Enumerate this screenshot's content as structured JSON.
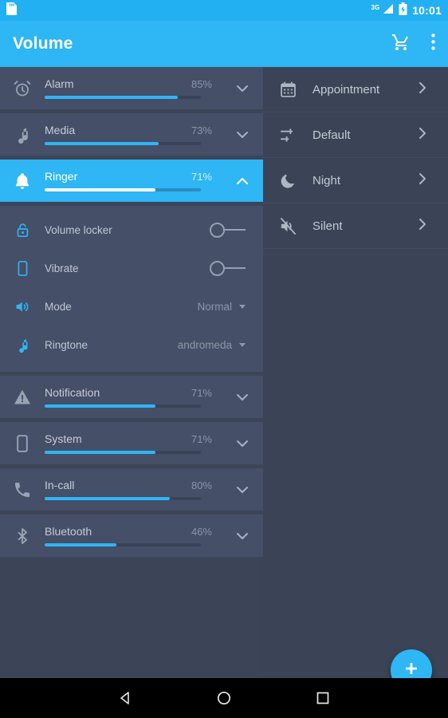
{
  "statusbar": {
    "sd_icon": "sd-card-icon",
    "network": "3G",
    "battery_icon": "battery-charging-icon",
    "time": "10:01"
  },
  "appbar": {
    "title": "Volume",
    "cart_icon": "shopping-cart-icon",
    "overflow_icon": "more-vertical-icon"
  },
  "volumes": [
    {
      "label": "Alarm",
      "percent": "85%",
      "value": 85,
      "icon": "alarm-clock-icon",
      "expanded": false,
      "selected": false,
      "chevron": "chevron-down-icon"
    },
    {
      "label": "Media",
      "percent": "73%",
      "value": 73,
      "icon": "music-note-icon",
      "expanded": false,
      "selected": false,
      "chevron": "chevron-down-icon"
    },
    {
      "label": "Ringer",
      "percent": "71%",
      "value": 71,
      "icon": "bell-icon",
      "expanded": true,
      "selected": true,
      "chevron": "chevron-up-icon"
    },
    {
      "label": "Notification",
      "percent": "71%",
      "value": 71,
      "icon": "warning-icon",
      "expanded": false,
      "selected": false,
      "chevron": "chevron-down-icon"
    },
    {
      "label": "System",
      "percent": "71%",
      "value": 71,
      "icon": "phone-body-icon",
      "expanded": false,
      "selected": false,
      "chevron": "chevron-down-icon"
    },
    {
      "label": "In-call",
      "percent": "80%",
      "value": 80,
      "icon": "phone-call-icon",
      "expanded": false,
      "selected": false,
      "chevron": "chevron-down-icon"
    },
    {
      "label": "Bluetooth",
      "percent": "46%",
      "value": 46,
      "icon": "bluetooth-icon",
      "expanded": false,
      "selected": false,
      "chevron": "chevron-down-icon"
    }
  ],
  "ringer_options": {
    "volume_locker": {
      "label": "Volume locker",
      "icon": "unlock-icon",
      "type": "toggle",
      "state": "off"
    },
    "vibrate": {
      "label": "Vibrate",
      "icon": "phone-body-icon",
      "type": "toggle",
      "state": "off"
    },
    "mode": {
      "label": "Mode",
      "icon": "speaker-icon",
      "type": "dropdown",
      "value": "Normal"
    },
    "ringtone": {
      "label": "Ringtone",
      "icon": "music-note-icon",
      "type": "dropdown",
      "value": "andromeda"
    }
  },
  "profiles": [
    {
      "label": "Appointment",
      "icon": "calendar-icon",
      "chevron": "chevron-right-icon"
    },
    {
      "label": "Default",
      "icon": "sliders-icon",
      "chevron": "chevron-right-icon"
    },
    {
      "label": "Night",
      "icon": "moon-icon",
      "chevron": "chevron-right-icon"
    },
    {
      "label": "Silent",
      "icon": "speaker-mute-icon",
      "chevron": "chevron-right-icon"
    }
  ],
  "fab": {
    "icon": "plus-icon",
    "color": "#2eb6f5"
  },
  "navbar": {
    "back": "back-triangle-icon",
    "home": "home-circle-icon",
    "recents": "recents-square-icon"
  },
  "colors": {
    "accent": "#2eb6f5",
    "appbar": "#2eb6f5",
    "statusbar": "#23b0f2",
    "card": "#454f67",
    "page": "#3c4557"
  }
}
